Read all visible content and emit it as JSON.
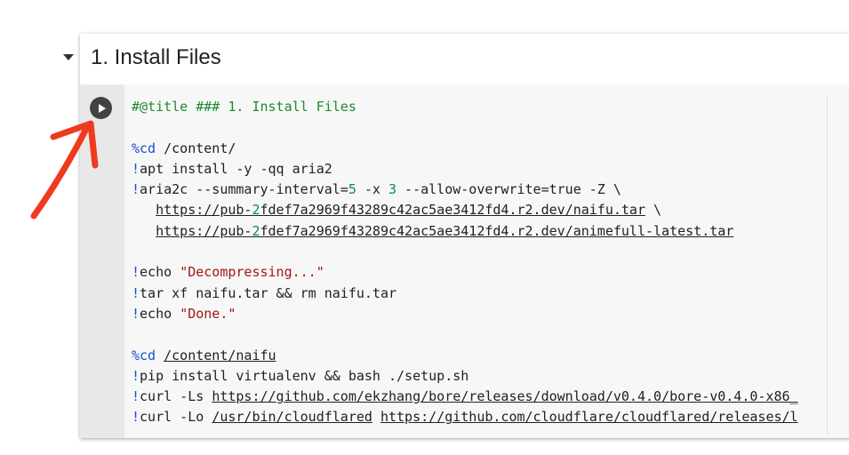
{
  "section": {
    "title": "1. Install Files"
  },
  "code": {
    "title_comment": "#@title ### 1. Install Files",
    "l_cd1_magic": "%cd",
    "l_cd1_rest": " /content/",
    "l_apt_bang": "!",
    "l_apt_rest": "apt install -y -qq aria2",
    "l_aria_bang": "!",
    "l_aria_a": "aria2c --summary-interval=",
    "l_aria_n1": "5",
    "l_aria_b": " -x ",
    "l_aria_n2": "3",
    "l_aria_c": " --allow-overwrite=true -Z \\",
    "l_url1_indent": "   ",
    "l_url1_a": "https://pub-",
    "l_url1_n": "2",
    "l_url1_b": "fdef7a2969f43289c42ac5ae3412fd4.r2.dev/naifu.tar",
    "l_url1_tail": " \\",
    "l_url2_indent": "   ",
    "l_url2_a": "https://pub-",
    "l_url2_n": "2",
    "l_url2_b": "fdef7a2969f43289c42ac5ae3412fd4.r2.dev/animefull-latest.tar",
    "l_echo1_bang": "!",
    "l_echo1_cmd": "echo ",
    "l_echo1_str": "\"Decompressing...\"",
    "l_tar_bang": "!",
    "l_tar_rest": "tar xf naifu.tar && rm naifu.tar",
    "l_echo2_bang": "!",
    "l_echo2_cmd": "echo ",
    "l_echo2_str": "\"Done.\"",
    "l_cd2_magic": "%cd",
    "l_cd2_sp": " ",
    "l_cd2_path": "/content/naifu",
    "l_pip_bang": "!",
    "l_pip_rest": "pip install virtualenv && bash ./setup.sh",
    "l_curl1_bang": "!",
    "l_curl1_a": "curl -Ls ",
    "l_curl1_link": "https://github.com/ekzhang/bore/releases/download/v0.4.0/bore-v0.4.0-x86_",
    "l_curl2_bang": "!",
    "l_curl2_a": "curl -Lo ",
    "l_curl2_path": "/usr/bin/cloudflared",
    "l_curl2_sp": " ",
    "l_curl2_link": "https://github.com/cloudflare/cloudflared/releases/l"
  },
  "colors": {
    "comment": "#1e8a2e",
    "magic": "#1a4fcf",
    "number": "#098658",
    "string": "#a31515",
    "annotation_arrow": "#f0391e"
  },
  "icons": {
    "run": "play-circle-icon",
    "collapse": "caret-down-icon",
    "annotation": "red-arrow"
  }
}
